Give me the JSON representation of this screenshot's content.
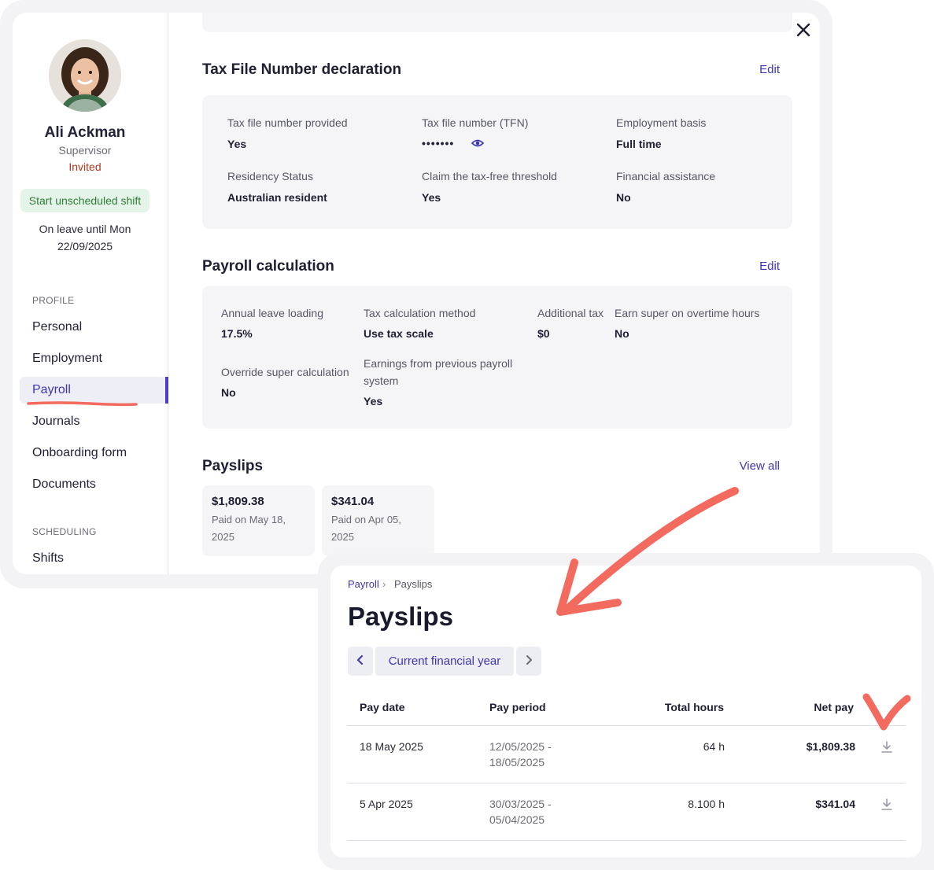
{
  "profile": {
    "name": "Ali Ackman",
    "role": "Supervisor",
    "status": "Invited",
    "shift_button": "Start unscheduled shift",
    "leave_line1": "On leave until Mon",
    "leave_line2": "22/09/2025"
  },
  "nav": {
    "section_profile": "PROFILE",
    "personal": "Personal",
    "employment": "Employment",
    "payroll": "Payroll",
    "journals": "Journals",
    "onboarding": "Onboarding form",
    "documents": "Documents",
    "section_scheduling": "SCHEDULING",
    "shifts": "Shifts"
  },
  "tfn": {
    "title": "Tax File Number declaration",
    "edit": "Edit",
    "provided_label": "Tax file number provided",
    "provided_value": "Yes",
    "tfn_label": "Tax file number (TFN)",
    "tfn_value": "•••••••",
    "basis_label": "Employment basis",
    "basis_value": "Full time",
    "residency_label": "Residency Status",
    "residency_value": "Australian resident",
    "threshold_label": "Claim the tax-free threshold",
    "threshold_value": "Yes",
    "assistance_label": "Financial assistance",
    "assistance_value": "No"
  },
  "payroll_calc": {
    "title": "Payroll calculation",
    "edit": "Edit",
    "leave_loading_label": "Annual leave loading",
    "leave_loading_value": "17.5%",
    "tax_method_label": "Tax calculation method",
    "tax_method_value": "Use tax scale",
    "additional_tax_label": "Additional tax",
    "additional_tax_value": "$0",
    "overtime_super_label": "Earn super on overtime hours",
    "overtime_super_value": "No",
    "override_label": "Override super calculation",
    "override_value": "No",
    "earnings_label_1": "Earnings from previous payroll",
    "earnings_label_2": "system",
    "earnings_value": "Yes"
  },
  "payslips_summary": {
    "title": "Payslips",
    "view_all": "View all",
    "cards": [
      {
        "amount": "$1,809.38",
        "date_line1": "Paid on May 18,",
        "date_line2": "2025"
      },
      {
        "amount": "$341.04",
        "date_line1": "Paid on Apr 05, 2025"
      }
    ]
  },
  "payslips_page": {
    "breadcrumb_parent": "Payroll",
    "breadcrumb_sep": "›",
    "breadcrumb_current": "Payslips",
    "title": "Payslips",
    "period_label": "Current financial year",
    "columns": {
      "pay_date": "Pay date",
      "pay_period": "Pay period",
      "total_hours": "Total hours",
      "net_pay": "Net pay"
    },
    "rows": [
      {
        "pay_date": "18 May 2025",
        "period_line1": "12/05/2025 -",
        "period_line2": "18/05/2025",
        "hours": "64 h",
        "net_pay": "$1,809.38"
      },
      {
        "pay_date": "5 Apr 2025",
        "period_line1": "30/03/2025 -",
        "period_line2": "05/04/2025",
        "hours": "8.100 h",
        "net_pay": "$341.04"
      }
    ]
  },
  "colors": {
    "accent": "#3c36b0",
    "annotation": "#f26b5e",
    "success_bg": "#e5f4e8",
    "success_text": "#2e7d36",
    "invited": "#b4371f"
  }
}
